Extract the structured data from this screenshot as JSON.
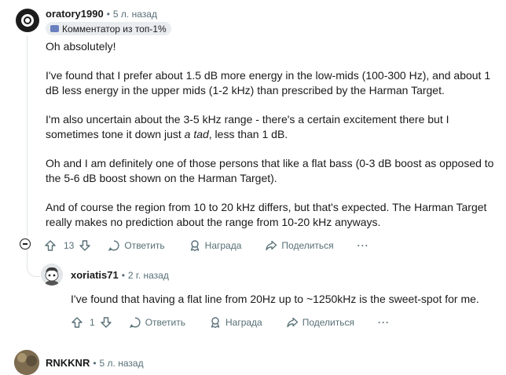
{
  "comment": {
    "username": "oratory1990",
    "time": "5 л. назад",
    "badge": "Комментатор из топ-1%",
    "paragraphs": [
      "Oh absolutely!",
      "I've found that I prefer about 1.5 dB more energy in the low-mids (100-300 Hz), and about 1 dB less energy in the upper mids (1-2 kHz) than prescribed by the Harman Target.",
      "I'm also uncertain about the 3-5 kHz range - there's a certain excitement there but I sometimes tone it down just ",
      "a tad",
      ", less than 1 dB.",
      "Oh and I am definitely one of those persons that like a flat bass (0-3 dB boost as opposed to the 5-6 dB boost shown on the Harman Target).",
      "And of course the region from 10 to 20 kHz differs, but that's expected. The Harman Target really makes no prediction about the range from 10-20 kHz anyways."
    ],
    "votes": "13",
    "reply_label": "Ответить",
    "award_label": "Награда",
    "share_label": "Поделиться",
    "more_label": "···"
  },
  "reply": {
    "username": "xoriatis71",
    "time": "2 г. назад",
    "text": "I've found that having a flat line from 20Hz up to ~1250kHz is the sweet-spot for me.",
    "votes": "1",
    "reply_label": "Ответить",
    "award_label": "Награда",
    "share_label": "Поделиться",
    "more_label": "···"
  },
  "next_comment": {
    "username": "RNKKNR",
    "time": "5 л. назад"
  }
}
